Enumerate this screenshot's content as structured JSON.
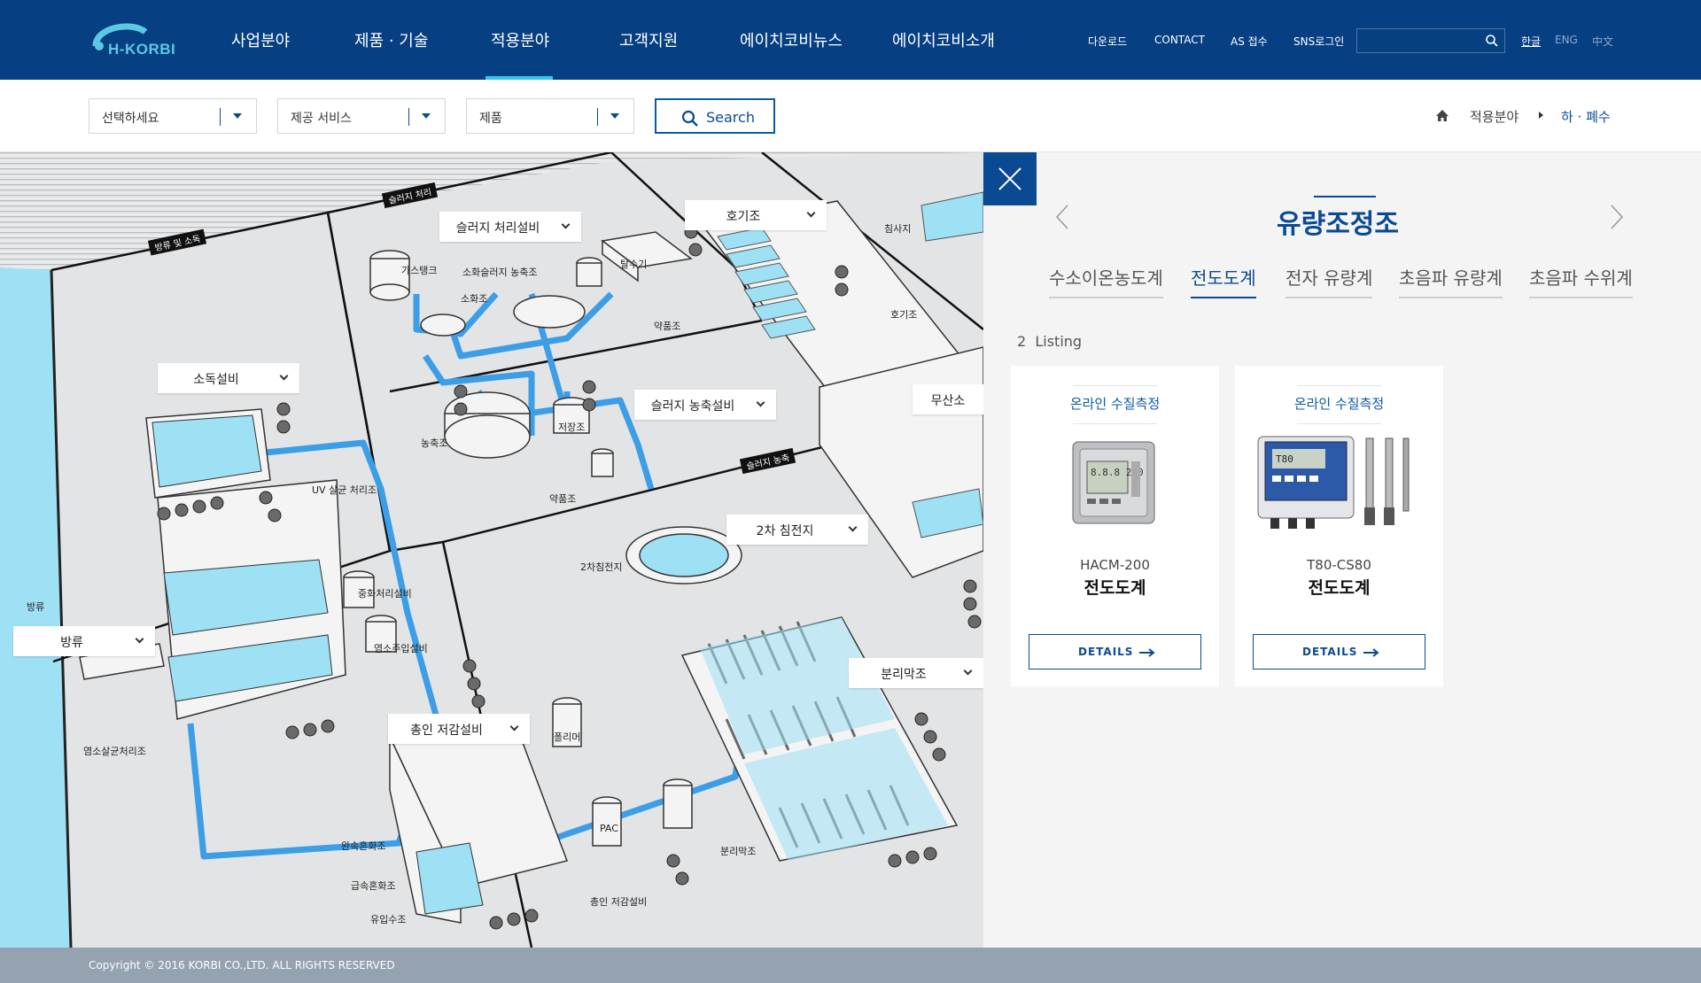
{
  "header": {
    "logo_text": "H-KORBI",
    "nav": [
      "사업분야",
      "제품 · 기술",
      "적용분야",
      "고객지원",
      "에이치코비뉴스",
      "에이치코비소개"
    ],
    "active_nav": "적용분야",
    "util": [
      "다운로드",
      "CONTACT",
      "AS 접수",
      "SNS로그인"
    ],
    "search_placeholder": "",
    "languages": [
      "한글",
      "ENG",
      "中文"
    ],
    "active_language": "한글"
  },
  "filters": {
    "select1": "선택하세요",
    "select2": "제공 서비스",
    "select3": "제품",
    "search_label": "Search"
  },
  "breadcrumb": [
    "적용분야",
    "하 · 폐수"
  ],
  "map": {
    "tags": [
      "슬러지 처리설비",
      "호기조",
      "소독설비",
      "슬러지 농축설비",
      "2차 침전지",
      "방류",
      "분리막조",
      "총인 저감설비",
      "무산소"
    ],
    "zones": [
      "방류 및 소독",
      "슬러지 처리",
      "슬러지 농축"
    ],
    "labels": [
      "가스탱크",
      "소화슬러지 농축조",
      "소화조",
      "탈수기",
      "약품조",
      "침사지",
      "호기조",
      "농축조",
      "저장조",
      "약품조",
      "UV 살균 처리조",
      "2차침전지",
      "중화처리설비",
      "염소주입설비",
      "방류",
      "염소살균처리조",
      "폴리머",
      "PAC",
      "완속혼화조",
      "급속혼화조",
      "유입수조",
      "총인 저감설비",
      "분리막조"
    ]
  },
  "panel": {
    "title": "유량조정조",
    "tabs": [
      "수소이온농도계",
      "전도도계",
      "전자 유량계",
      "초음파 유량계",
      "초음파 수위계"
    ],
    "active_tab": "전도도계",
    "listing_count": "2",
    "listing_label": "Listing",
    "products": [
      {
        "category": "온라인 수질측정",
        "model": "HACM-200",
        "name": "전도도계",
        "button": "DETAILS",
        "display": "8.8.8 250"
      },
      {
        "category": "온라인 수질측정",
        "model": "T80-CS80",
        "name": "전도도계",
        "button": "DETAILS",
        "display": "T80"
      }
    ]
  },
  "footer": {
    "copyright": "Copyright © 2016 KORBI CO.,LTD. ALL RIGHTS RESERVED"
  },
  "colors": {
    "brand": "#063f82",
    "accent": "#37c6ea",
    "water": "#9ee0f4",
    "pipe": "#3b9ee6"
  }
}
